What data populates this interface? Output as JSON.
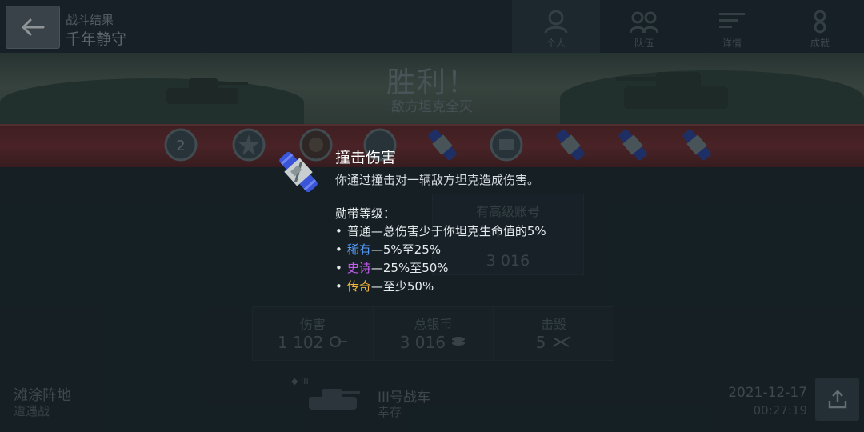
{
  "header": {
    "breadcrumb": "战斗结果",
    "map_title": "千年静守",
    "tabs": [
      {
        "label": "个人",
        "icon": "personal-icon",
        "active": true
      },
      {
        "label": "队伍",
        "icon": "team-icon",
        "active": false
      },
      {
        "label": "详情",
        "icon": "details-icon",
        "active": false
      },
      {
        "label": "成就",
        "icon": "achievements-icon",
        "active": false
      }
    ]
  },
  "banner": {
    "result": "胜利！",
    "subtitle": "敌方坦克全灭"
  },
  "medals": [
    "mastery-2-medal",
    "medal-2",
    "medal-3",
    "medal-4",
    "ramming-ribbon",
    "medal-6",
    "ribbon-7",
    "ribbon-8",
    "ribbon-9"
  ],
  "premium_panel": {
    "label": "有高级账号",
    "value": "3 016"
  },
  "stats": [
    {
      "label": "伤害",
      "value": "1 102",
      "icon": "damage-icon"
    },
    {
      "label": "总银币",
      "value": "3 016",
      "icon": "silver-icon"
    },
    {
      "label": "击毁",
      "value": "5",
      "icon": "kills-icon"
    }
  ],
  "footer": {
    "map": "滩涂阵地",
    "mode": "遭遇战",
    "tier": "III",
    "tank": "III号战车",
    "status": "幸存",
    "date": "2021-12-17",
    "time": "00:27:19"
  },
  "tooltip": {
    "title": "撞击伤害",
    "description": "你通过撞击对一辆敌方坦克造成伤害。",
    "grades_heading": "勋带等级：",
    "grades": [
      {
        "bullet": "•",
        "rarity": "普通",
        "text": "—总伤害少于你坦克生命值的5%"
      },
      {
        "bullet": "•",
        "rarity": "稀有",
        "text": "—5%至25%"
      },
      {
        "bullet": "•",
        "rarity": "史诗",
        "text": "—25%至50%"
      },
      {
        "bullet": "•",
        "rarity": "传奇",
        "text": "—至少50%"
      }
    ]
  },
  "colors": {
    "common": "#e6ecee",
    "rare": "#5aa0ff",
    "epic": "#c45cf0",
    "legendary": "#f3b43c",
    "ribbon": "#7d3234"
  }
}
